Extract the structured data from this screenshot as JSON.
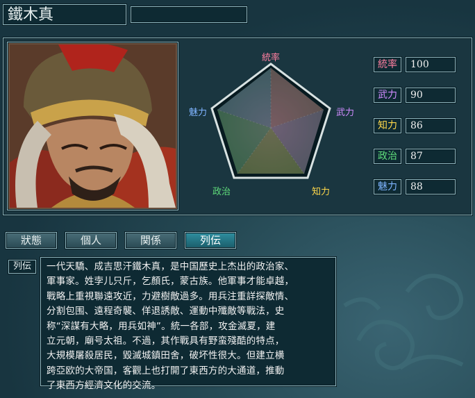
{
  "character": {
    "name": "鐵木真",
    "title": ""
  },
  "radar_labels": {
    "top": "統率",
    "right": "武力",
    "bottom_right": "知力",
    "bottom_left": "政治",
    "left": "魅力"
  },
  "stats": [
    {
      "label": "統率",
      "value": "100",
      "color": "#ff7fa0"
    },
    {
      "label": "武力",
      "value": "90",
      "color": "#d08bff"
    },
    {
      "label": "知力",
      "value": "86",
      "color": "#ffd84a"
    },
    {
      "label": "政治",
      "value": "87",
      "color": "#5fdc7a"
    },
    {
      "label": "魅力",
      "value": "88",
      "color": "#7fb4ff"
    }
  ],
  "tabs": [
    {
      "label": "狀態",
      "active": false
    },
    {
      "label": "個人",
      "active": false
    },
    {
      "label": "関係",
      "active": false
    },
    {
      "label": "列伝",
      "active": true
    }
  ],
  "biography": {
    "label": "列伝",
    "lines": [
      "一代天驕、成吉思汗鐵木真，是中国歷史上杰出的政治家、",
      "軍事家。姓孛儿只斤，乞顏氏，蒙古族。他軍事才能卓越，",
      "戰略上重視聯遠攻近，力避樹敵過多。用兵注重詳探敵情、",
      "分割包围、遠程奇襲、佯退誘敵、運動中殲敵等戰法，史",
      "称“深謀有大略，用兵如神”。統一各部，攻金滅夏，建",
      "立元朝，廟号太祖。不過，其作戰具有野蛮殘酷的特点，",
      "大規模屠殺居民，毀滅城鎮田舍，破坏性很大。但建立横",
      "跨亞欧的大帝国，客觀上也打開了東西方的大通道，推動",
      "了東西方經濟文化的交流。"
    ]
  },
  "colors": {
    "accent": "#2f8fa0",
    "panel": "#0e2a33"
  }
}
